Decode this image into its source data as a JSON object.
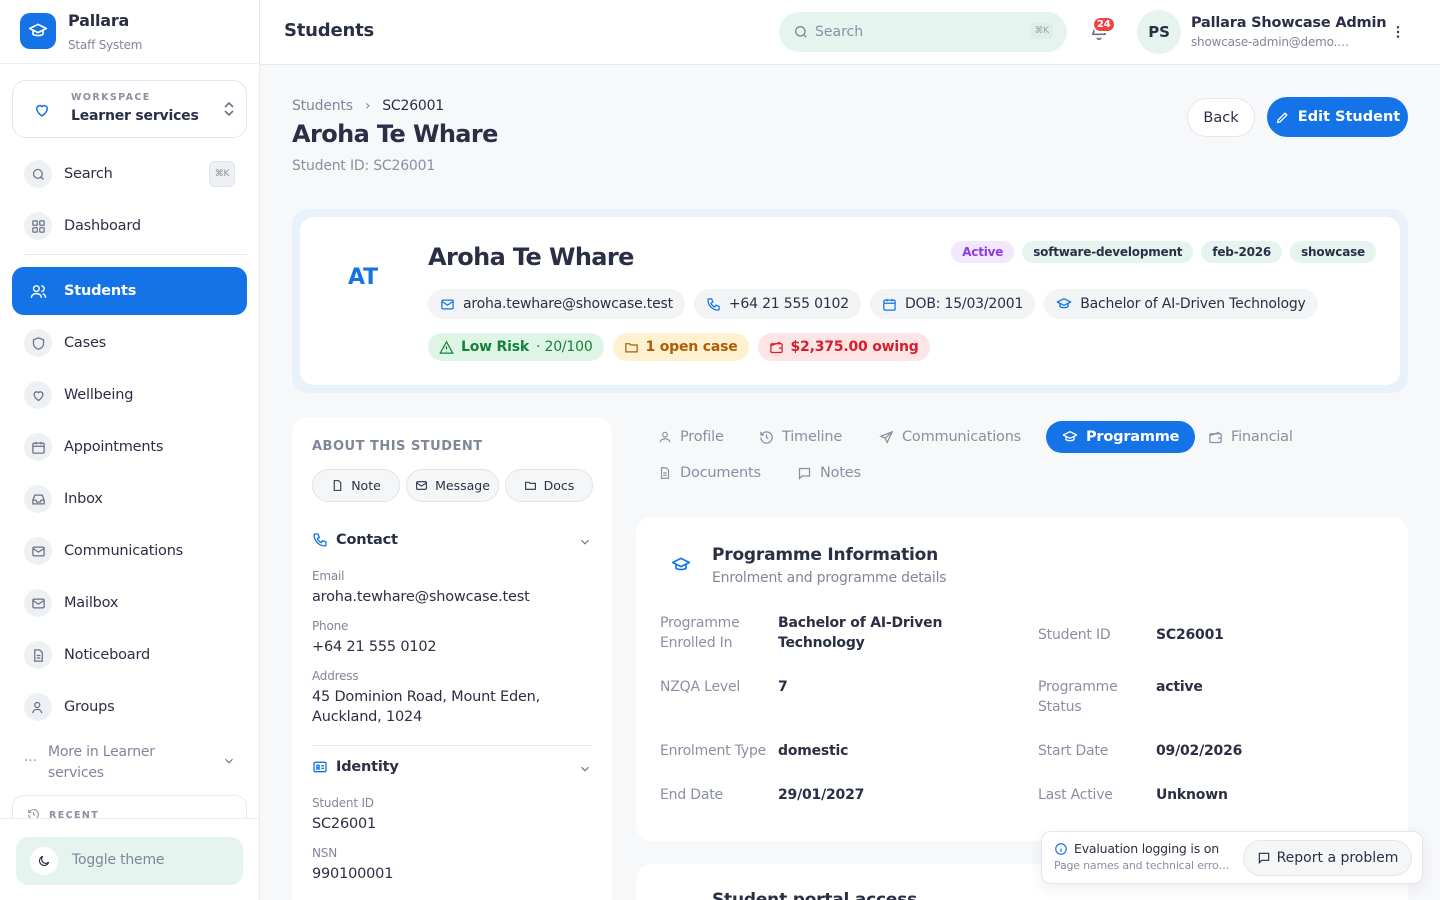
{
  "app": {
    "name": "Pallara",
    "subtitle": "Staff System"
  },
  "workspace": {
    "label": "WORKSPACE",
    "name": "Learner services"
  },
  "sidebar": {
    "search": {
      "label": "Search",
      "kbd": "⌘K"
    },
    "items": [
      {
        "label": "Dashboard",
        "icon": "grid-icon"
      },
      {
        "label": "Students",
        "icon": "users-icon",
        "active": true
      },
      {
        "label": "Cases",
        "icon": "shield-icon"
      },
      {
        "label": "Wellbeing",
        "icon": "heart-icon"
      },
      {
        "label": "Appointments",
        "icon": "calendar-icon"
      },
      {
        "label": "Inbox",
        "icon": "inbox-icon"
      },
      {
        "label": "Communications",
        "icon": "mail-icon"
      },
      {
        "label": "Mailbox",
        "icon": "mail-icon"
      },
      {
        "label": "Noticeboard",
        "icon": "file-icon"
      },
      {
        "label": "Groups",
        "icon": "users-icon"
      }
    ],
    "more": "More in Learner services",
    "recent": "RECENT",
    "toggle_theme": "Toggle theme"
  },
  "topbar": {
    "title": "Students",
    "search_placeholder": "Search",
    "search_kbd": "⌘K",
    "notifications": "24",
    "user": {
      "initials": "PS",
      "name": "Pallara Showcase Admin",
      "email": "showcase-admin@demo.pallara.test"
    }
  },
  "breadcrumb": {
    "parent": "Students",
    "separator": "›",
    "current": "SC26001"
  },
  "page": {
    "title": "Aroha Te Whare",
    "student_id_line": "Student ID: SC26001",
    "back": "Back",
    "edit": "Edit Student"
  },
  "hero": {
    "initials": "AT",
    "name": "Aroha Te Whare",
    "tags": [
      "Active",
      "software-development",
      "feb-2026",
      "showcase"
    ],
    "email": "aroha.tewhare@showcase.test",
    "phone": "+64 21 555 0102",
    "dob": "DOB: 15/03/2001",
    "programme": "Bachelor of AI-Driven Technology",
    "risk": "Low Risk",
    "risk_score": "· 20/100",
    "cases": "1 open case",
    "owing": "$2,375.00 owing"
  },
  "about": {
    "heading": "ABOUT THIS STUDENT",
    "buttons": [
      "Note",
      "Message",
      "Docs"
    ],
    "contact": {
      "title": "Contact",
      "email_label": "Email",
      "email": "aroha.tewhare@showcase.test",
      "phone_label": "Phone",
      "phone": "+64 21 555 0102",
      "address_label": "Address",
      "address": "45 Dominion Road, Mount Eden, Auckland, 1024"
    },
    "identity": {
      "title": "Identity",
      "sid_label": "Student ID",
      "sid": "SC26001",
      "nsn_label": "NSN",
      "nsn": "990100001"
    }
  },
  "tabs": [
    "Profile",
    "Timeline",
    "Communications",
    "Programme",
    "Financial",
    "Documents",
    "Notes"
  ],
  "programme": {
    "title": "Programme Information",
    "subtitle": "Enrolment and programme details",
    "fields": {
      "enrolled_label": "Programme Enrolled In",
      "enrolled": "Bachelor of AI-Driven Technology",
      "sid_label": "Student ID",
      "sid": "SC26001",
      "nzqa_label": "NZQA Level",
      "nzqa": "7",
      "status_label": "Programme Status",
      "status": "active",
      "type_label": "Enrolment Type",
      "type": "domestic",
      "start_label": "Start Date",
      "start": "09/02/2026",
      "end_label": "End Date",
      "end": "29/01/2027",
      "last_label": "Last Active",
      "last": "Unknown"
    }
  },
  "next_section": "Student portal access",
  "toast": {
    "title": "Evaluation logging is on",
    "subtitle": "Page names and technical errors are logged",
    "button": "Report a problem"
  }
}
